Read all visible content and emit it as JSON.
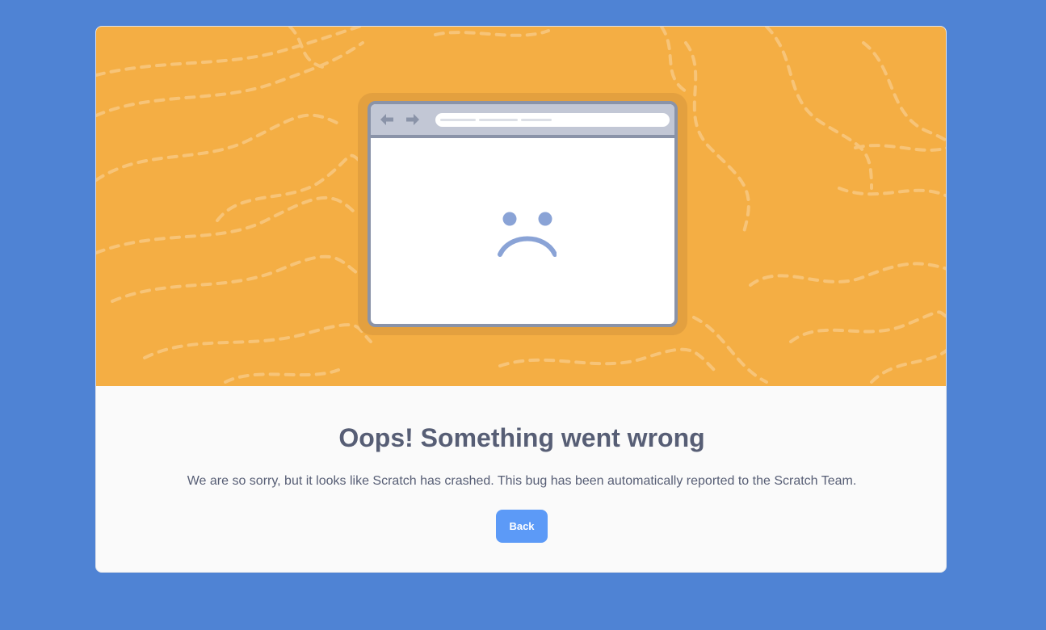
{
  "error_card": {
    "title": "Oops! Something went wrong",
    "message": "We are so sorry, but it looks like Scratch has crashed. This bug has been automatically reported to the Scratch Team.",
    "back_label": "Back"
  },
  "illustration": {
    "icons": [
      "back-arrow-icon",
      "forward-arrow-icon",
      "sad-face-icon"
    ]
  },
  "colors": {
    "page_background": "#4f83d4",
    "illustration_background": "#f4ae44",
    "card_background": "#fafafa",
    "text": "#575e75",
    "button": "#5c9af7",
    "browser_frame": "#8a93a8",
    "sad_face": "#8aa3d6"
  }
}
